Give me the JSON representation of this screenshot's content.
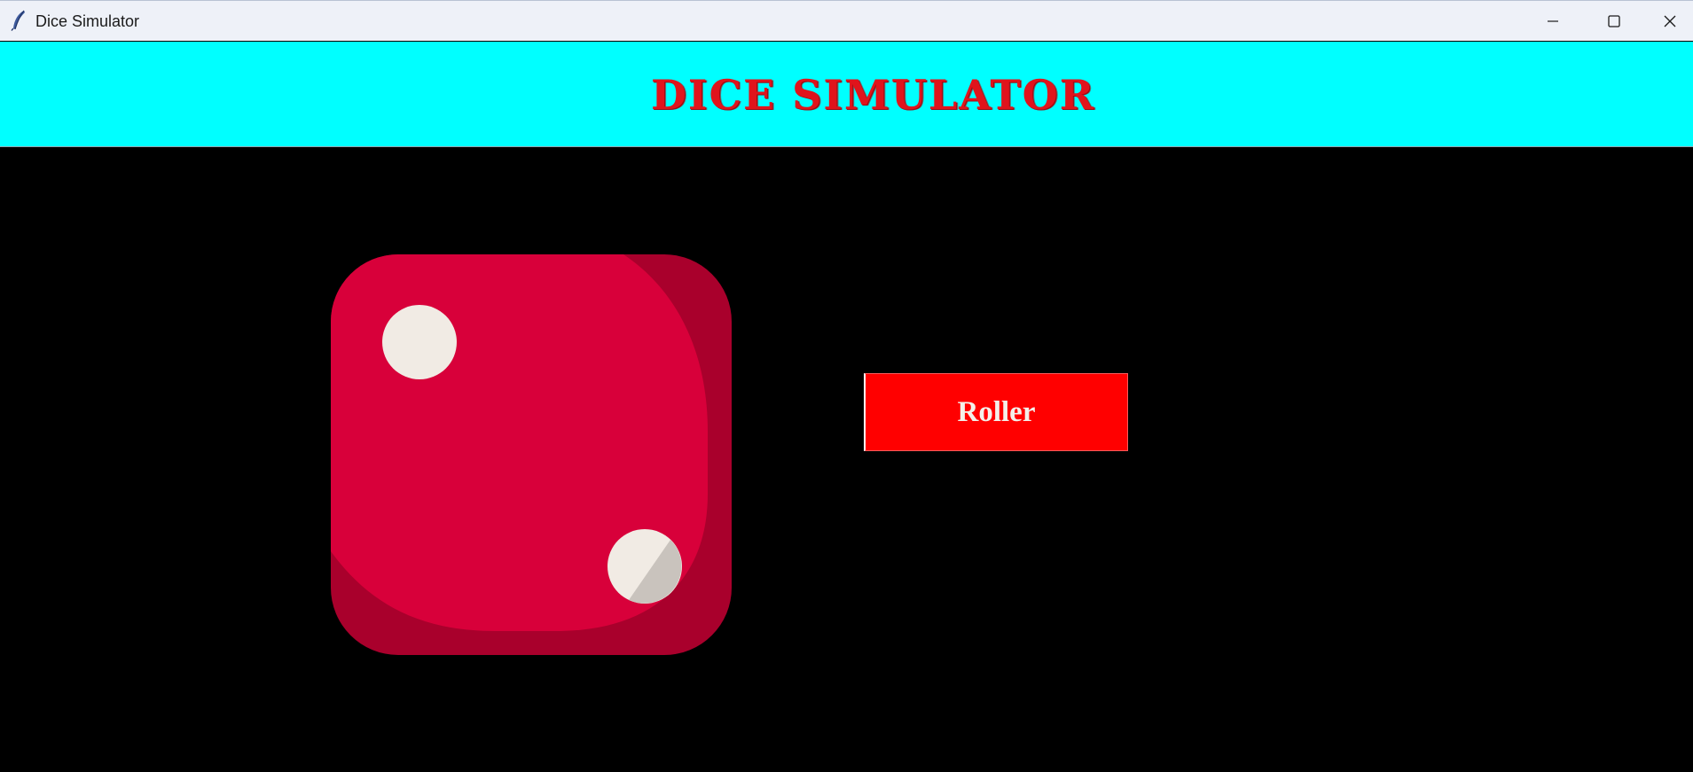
{
  "window": {
    "title": "Dice Simulator",
    "controls": {
      "minimize_icon": "minimize-icon",
      "maximize_icon": "maximize-icon",
      "close_icon": "close-icon"
    },
    "app_icon": "feather-icon"
  },
  "header": {
    "heading": "Dice Simulator",
    "background_color": "#00ffff",
    "heading_color": "#e0141c"
  },
  "main": {
    "background_color": "#000000",
    "dice": {
      "face_value": 2,
      "body_color": "#d8003a",
      "shadow_color": "#a9002c",
      "pip_color": "#f1ebe4"
    },
    "roll_button": {
      "label": "Roller",
      "background_color": "#ff0000",
      "label_color": "#f4f0ea"
    }
  }
}
